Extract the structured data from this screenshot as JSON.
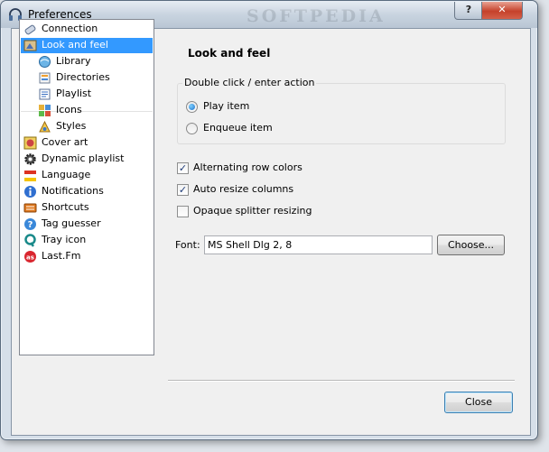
{
  "window": {
    "title": "Preferences",
    "watermark": "SOFTPEDIA"
  },
  "titlebar_buttons": {
    "help": "?",
    "close": "✕"
  },
  "sidebar": {
    "items": [
      {
        "label": "Connection",
        "icon": "connection-icon",
        "indent": false,
        "selected": false
      },
      {
        "label": "Look and feel",
        "icon": "look-and-feel-icon",
        "indent": false,
        "selected": true
      },
      {
        "label": "Library",
        "icon": "library-icon",
        "indent": true,
        "selected": false
      },
      {
        "label": "Directories",
        "icon": "directories-icon",
        "indent": true,
        "selected": false
      },
      {
        "label": "Playlist",
        "icon": "playlist-icon",
        "indent": true,
        "selected": false
      },
      {
        "label": "Icons",
        "icon": "icons-icon",
        "indent": true,
        "selected": false
      },
      {
        "label": "Styles",
        "icon": "styles-icon",
        "indent": true,
        "selected": false
      },
      {
        "label": "Cover art",
        "icon": "cover-art-icon",
        "indent": false,
        "selected": false
      },
      {
        "label": "Dynamic playlist",
        "icon": "gear-icon",
        "indent": false,
        "selected": false
      },
      {
        "label": "Language",
        "icon": "flag-icon",
        "indent": false,
        "selected": false
      },
      {
        "label": "Notifications",
        "icon": "info-icon",
        "indent": false,
        "selected": false
      },
      {
        "label": "Shortcuts",
        "icon": "keyboard-icon",
        "indent": false,
        "selected": false
      },
      {
        "label": "Tag guesser",
        "icon": "help-icon",
        "indent": false,
        "selected": false
      },
      {
        "label": "Tray icon",
        "icon": "tray-icon",
        "indent": false,
        "selected": false
      },
      {
        "label": "Last.Fm",
        "icon": "lastfm-icon",
        "indent": false,
        "selected": false
      }
    ]
  },
  "main": {
    "section_title": "Look and feel",
    "double_click": {
      "legend": "Double click / enter action",
      "options": [
        {
          "label": "Play item",
          "checked": true
        },
        {
          "label": "Enqueue item",
          "checked": false
        }
      ]
    },
    "checkboxes": [
      {
        "label": "Alternating row colors",
        "checked": true
      },
      {
        "label": "Auto resize columns",
        "checked": true
      },
      {
        "label": "Opaque splitter resizing",
        "checked": false
      }
    ],
    "font": {
      "label": "Font:",
      "value": "MS Shell Dlg 2, 8",
      "choose_label": "Choose..."
    }
  },
  "footer": {
    "close_label": "Close"
  },
  "colors": {
    "selection": "#3399ff",
    "titlebar_close": "#c5412a"
  }
}
